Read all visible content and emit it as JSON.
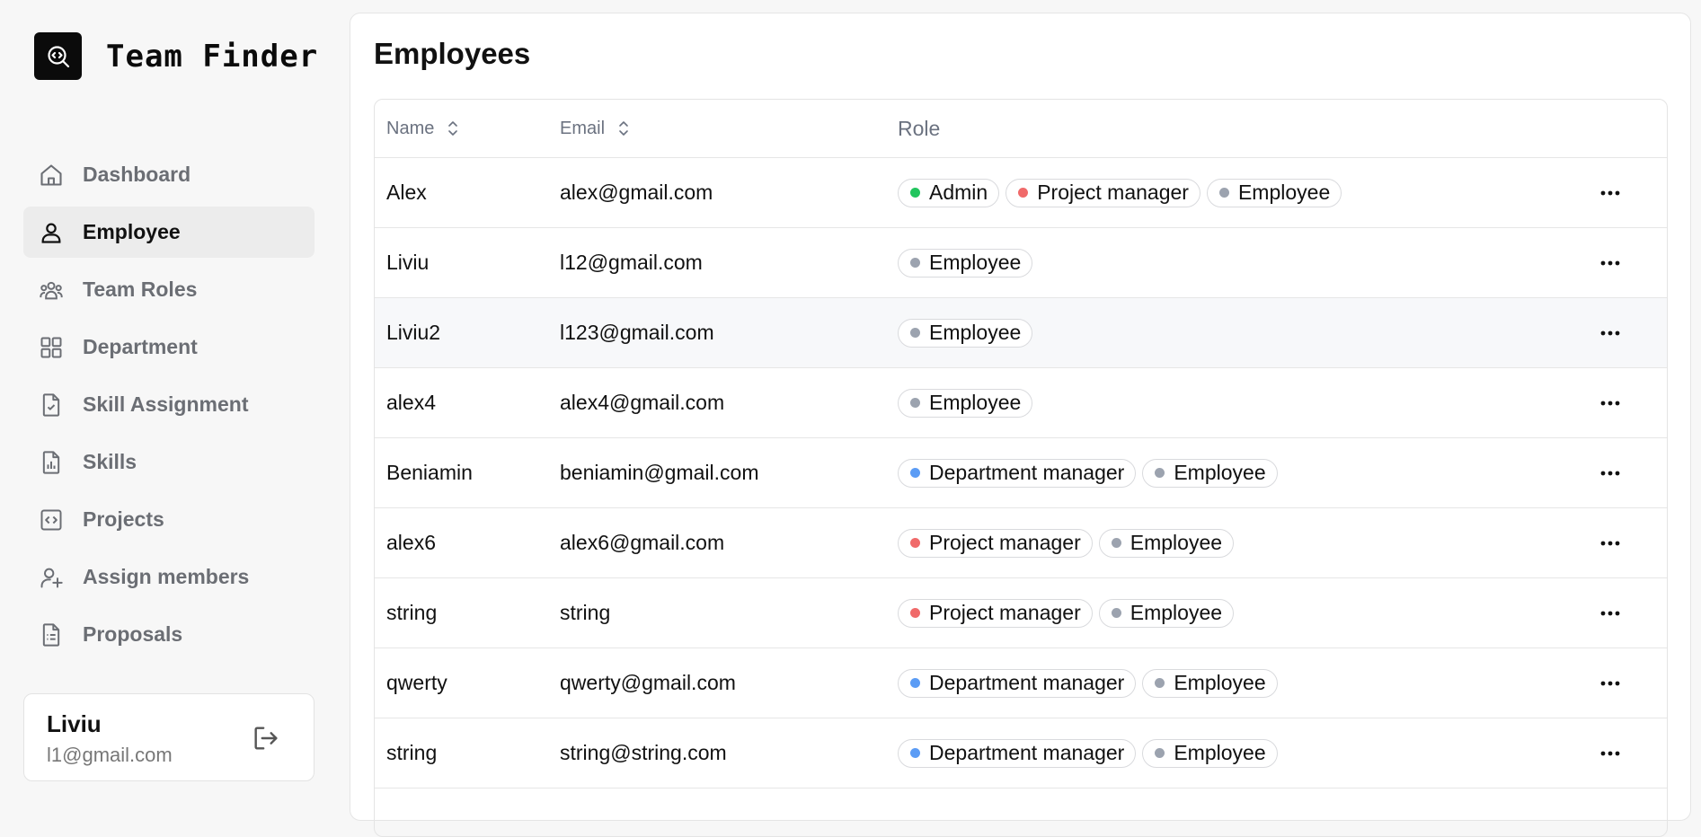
{
  "brand": {
    "name": "Team Finder",
    "logo_icon": "search-code-icon"
  },
  "nav": {
    "items": [
      {
        "label": "Dashboard",
        "icon": "home-icon",
        "active": false
      },
      {
        "label": "Employee",
        "icon": "user-icon",
        "active": true
      },
      {
        "label": "Team Roles",
        "icon": "users-icon",
        "active": false
      },
      {
        "label": "Department",
        "icon": "grid-icon",
        "active": false
      },
      {
        "label": "Skill Assignment",
        "icon": "file-check-icon",
        "active": false
      },
      {
        "label": "Skills",
        "icon": "file-chart-icon",
        "active": false
      },
      {
        "label": "Projects",
        "icon": "code-square-icon",
        "active": false
      },
      {
        "label": "Assign members",
        "icon": "user-plus-icon",
        "active": false
      },
      {
        "label": "Proposals",
        "icon": "file-list-icon",
        "active": false
      }
    ]
  },
  "user": {
    "name": "Liviu",
    "email": "l1@gmail.com",
    "logout_icon": "logout-icon"
  },
  "page": {
    "title": "Employees"
  },
  "table": {
    "columns": {
      "name": "Name",
      "email": "Email",
      "role": "Role"
    },
    "rows": [
      {
        "name": "Alex",
        "email": "alex@gmail.com",
        "roles": [
          "Admin",
          "Project manager",
          "Employee"
        ]
      },
      {
        "name": "Liviu",
        "email": "l12@gmail.com",
        "roles": [
          "Employee"
        ]
      },
      {
        "name": "Liviu2",
        "email": "l123@gmail.com",
        "roles": [
          "Employee"
        ]
      },
      {
        "name": "alex4",
        "email": "alex4@gmail.com",
        "roles": [
          "Employee"
        ]
      },
      {
        "name": "Beniamin",
        "email": "beniamin@gmail.com",
        "roles": [
          "Department manager",
          "Employee"
        ]
      },
      {
        "name": "alex6",
        "email": "alex6@gmail.com",
        "roles": [
          "Project manager",
          "Employee"
        ]
      },
      {
        "name": "string",
        "email": "string",
        "roles": [
          "Project manager",
          "Employee"
        ]
      },
      {
        "name": "qwerty",
        "email": "qwerty@gmail.com",
        "roles": [
          "Department manager",
          "Employee"
        ]
      },
      {
        "name": "string",
        "email": "string@string.com",
        "roles": [
          "Department manager",
          "Employee"
        ]
      },
      {
        "name": "",
        "email": "",
        "roles": []
      }
    ],
    "highlighted_row": 2
  },
  "role_colors": {
    "Admin": "#22c55e",
    "Project manager": "#f06a6a",
    "Department manager": "#5b9cf5",
    "Employee": "#9ca3af"
  }
}
